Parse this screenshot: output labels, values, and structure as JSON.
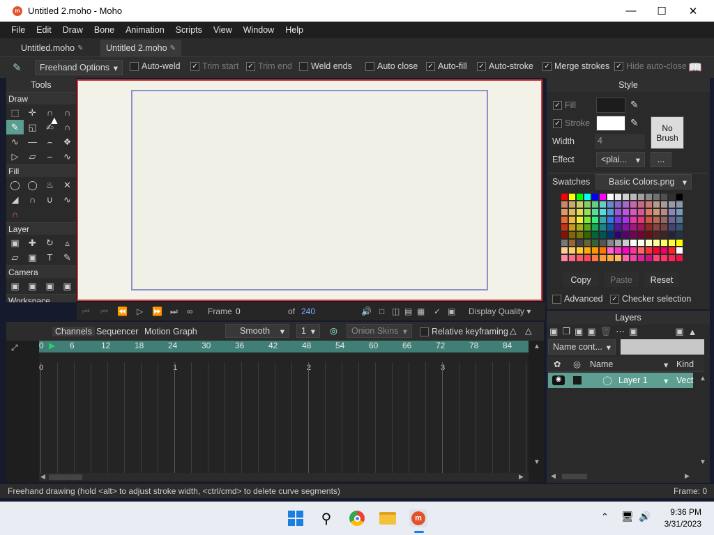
{
  "window": {
    "title": "Untitled 2.moho - Moho",
    "app_icon": "moho-icon"
  },
  "menu": [
    "File",
    "Edit",
    "Draw",
    "Bone",
    "Animation",
    "Scripts",
    "View",
    "Window",
    "Help"
  ],
  "tabs": [
    {
      "label": "Untitled.moho"
    },
    {
      "label": "Untitled 2.moho"
    }
  ],
  "options": {
    "tool_options": "Freehand Options",
    "auto_weld": "Auto-weld",
    "trim_start": "Trim start",
    "trim_end": "Trim end",
    "weld_ends": "Weld ends",
    "auto_close": "Auto close",
    "auto_fill": "Auto-fill",
    "auto_stroke": "Auto-stroke",
    "merge_strokes": "Merge strokes",
    "hide_auto_close": "Hide auto-close"
  },
  "tools": {
    "title": "Tools",
    "draw": "Draw",
    "fill": "Fill",
    "layer": "Layer",
    "camera": "Camera",
    "workspace": "Workspace"
  },
  "playback": {
    "frame_label": "Frame",
    "frame_value": "0",
    "of_label": "of",
    "total": "240",
    "quality": "Display Quality"
  },
  "timeline": {
    "tabs": [
      "Channels",
      "Sequencer",
      "Motion Graph"
    ],
    "interp": "Smooth",
    "interval": "1",
    "onion": "Onion Skins",
    "relative": "Relative keyframing",
    "ruler": [
      "0",
      "6",
      "12",
      "18",
      "24",
      "30",
      "36",
      "42",
      "48",
      "54",
      "60",
      "66",
      "72",
      "78",
      "84"
    ],
    "seconds": [
      "0",
      "1",
      "2",
      "3"
    ]
  },
  "style": {
    "title": "Style",
    "fill": "Fill",
    "stroke": "Stroke",
    "no_brush": "No Brush",
    "width_label": "Width",
    "width_value": "4",
    "effect_label": "Effect",
    "effect_value": "<plai...",
    "effect_more": "...",
    "swatches_label": "Swatches",
    "swatches_file": "Basic Colors.png",
    "copy": "Copy",
    "paste": "Paste",
    "reset": "Reset",
    "advanced": "Advanced",
    "checker": "Checker selection",
    "fill_color": "#1c1c1c",
    "stroke_color": "#ffffff"
  },
  "layers": {
    "title": "Layers",
    "filter": "Name cont...",
    "col_name": "Name",
    "col_kind": "Kind",
    "rows": [
      {
        "name": "Layer 1",
        "kind": "Vect"
      }
    ]
  },
  "status": {
    "message": "Freehand drawing (hold <alt> to adjust stroke width, <ctrl/cmd> to delete curve segments)",
    "frame": "Frame: 0"
  },
  "taskbar": {
    "time": "9:36 PM",
    "date": "3/31/2023"
  }
}
